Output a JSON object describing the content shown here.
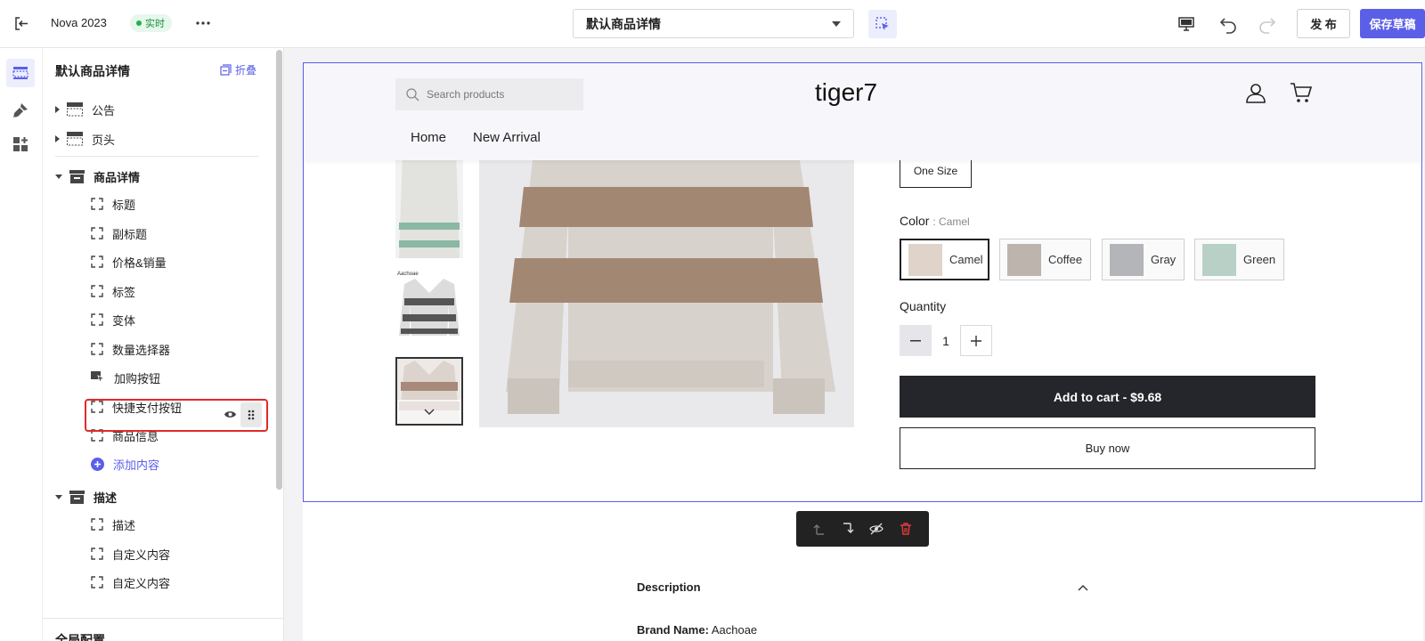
{
  "topbar": {
    "store_name": "Nova 2023",
    "live_badge": "实时",
    "page_select": "默认商品详情",
    "publish_label": "发 布",
    "save_draft_label": "保存草稿"
  },
  "sidebar": {
    "title": "默认商品详情",
    "collapse_label": "折叠",
    "sections": [
      {
        "label": "公告"
      },
      {
        "label": "页头"
      },
      {
        "label": "商品详情"
      },
      {
        "label": "描述"
      }
    ],
    "product_items": [
      "标题",
      "副标题",
      "价格&销量",
      "标签",
      "变体",
      "数量选择器",
      "加购按钮",
      "快捷支付按钮",
      "商品信息"
    ],
    "add_content_label": "添加内容",
    "description_items": [
      "描述",
      "自定义内容",
      "自定义内容"
    ],
    "global_config_label": "全局配置"
  },
  "preview": {
    "search_placeholder": "Search products",
    "brand": "tiger7",
    "nav": [
      "Home",
      "New Arrival"
    ],
    "size_option": "One Size",
    "color_label": "Color",
    "color_value": ": Camel",
    "colors": [
      "Camel",
      "Coffee",
      "Gray",
      "Green"
    ],
    "quantity_label": "Quantity",
    "quantity_value": "1",
    "add_to_cart_label": "Add to cart - $9.68",
    "buy_now_label": "Buy now",
    "thumb_caption": "Aachoae",
    "description_title": "Description",
    "brand_name_label": "Brand Name:",
    "brand_name_value": "Aachoae"
  },
  "colors": {
    "accent": "#5b5fe8",
    "highlight": "#e02a2a",
    "live_green": "#22b14c"
  }
}
